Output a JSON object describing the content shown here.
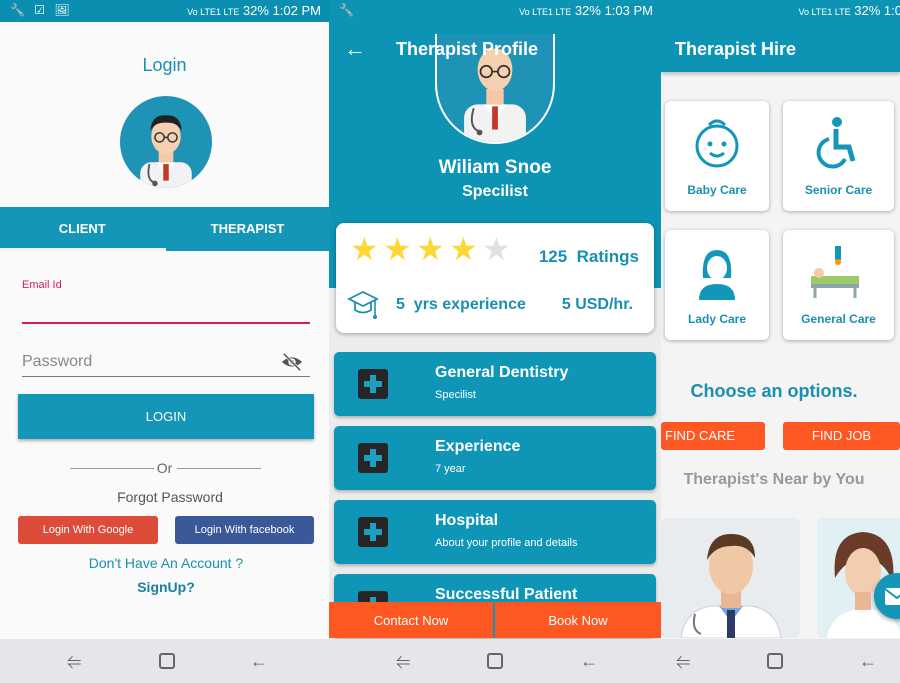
{
  "status": {
    "screen1": {
      "left": "🔧 ☑ 🖼",
      "signal": "Vo LTE1 LTE",
      "battery": "32%",
      "time": "1:02 PM"
    },
    "screen2": {
      "left": "🔧",
      "signal": "Vo LTE1 LTE",
      "battery": "32%",
      "time": "1:03 PM"
    },
    "screen3": {
      "left": "",
      "signal": "Vo LTE1 LTE",
      "battery": "32%",
      "time": "1:0"
    }
  },
  "login": {
    "title": "Login",
    "tabs": [
      "CLIENT",
      "THERAPIST"
    ],
    "email_label": "Email Id",
    "email_value": "",
    "password_placeholder": "Password",
    "login_button": "LOGIN",
    "or": "Or",
    "forgot": "Forgot Password",
    "google_button": "Login With Google",
    "facebook_button": "Login With facebook",
    "no_account": "Don't Have An Account ?",
    "signup": "SignUp?"
  },
  "profile": {
    "title": "Therapist Profile",
    "name": "Wiliam Snoe",
    "specialty": "Specilist",
    "rating_stars": 4,
    "rating_max": 5,
    "ratings_count": "125",
    "ratings_label": "Ratings",
    "experience_years": "5",
    "experience_label": "yrs experience",
    "rate": "5 USD/hr.",
    "items": [
      {
        "title": "General Dentistry",
        "subtitle": "Specilist"
      },
      {
        "title": "Experience",
        "subtitle": "7 year"
      },
      {
        "title": "Hospital",
        "subtitle": "About your profile and details"
      },
      {
        "title": "Successful Patient",
        "subtitle": ""
      }
    ],
    "contact_button": "Contact Now",
    "book_button": "Book Now"
  },
  "hire": {
    "title": "Therapist Hire",
    "categories": [
      "Baby Care",
      "Senior Care",
      "Lady Care",
      "General Care"
    ],
    "choose": "Choose an options.",
    "find_care": "FIND CARE",
    "find_job": "FIND JOB",
    "near": "Therapist's Near by You"
  },
  "colors": {
    "primary": "#1496b8",
    "accent": "#ff5722",
    "email_underline": "#d81b60",
    "google": "#dd4b39",
    "facebook": "#3b5998",
    "star_filled": "#fdd835",
    "star_empty": "#e0e0e0"
  }
}
